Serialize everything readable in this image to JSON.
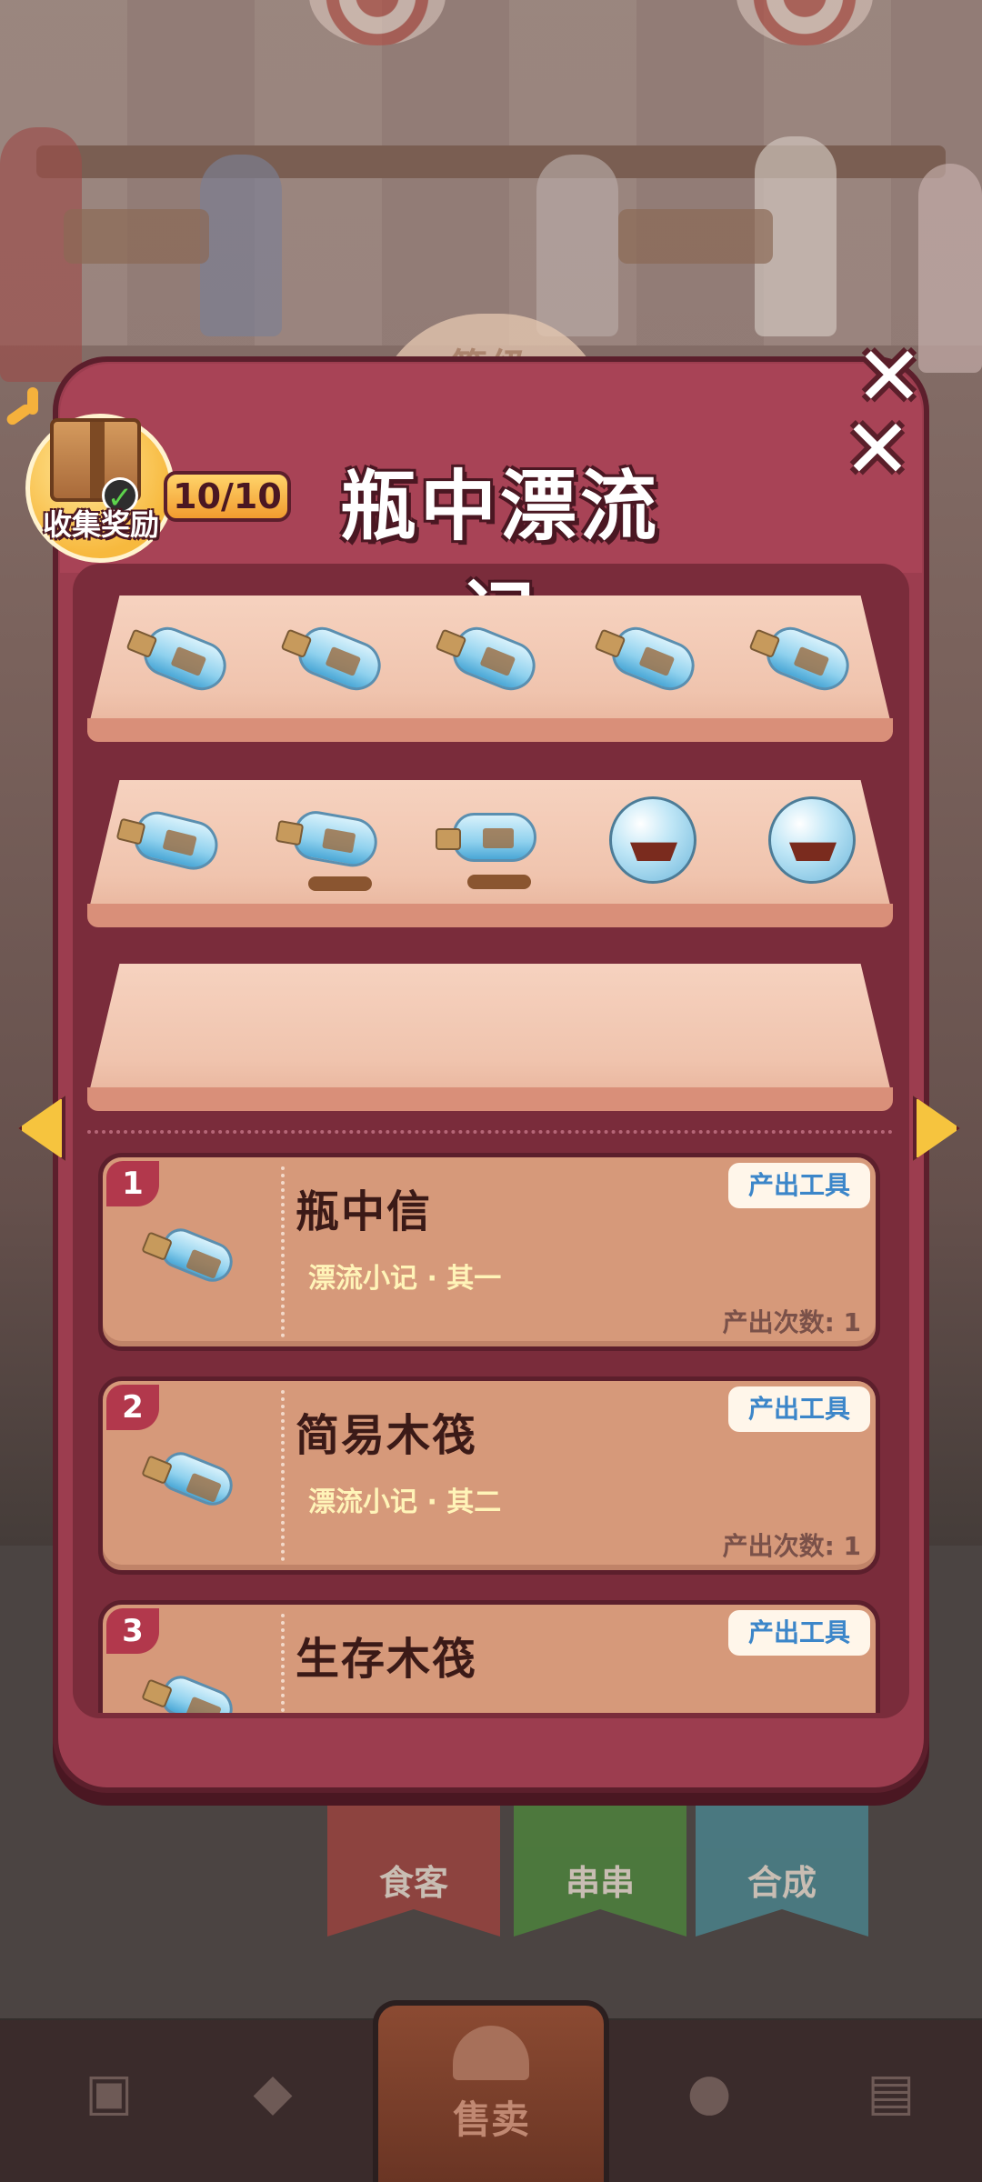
{
  "header": {
    "title": "瓶中漂流记",
    "progress": "10/10",
    "reward_label": "收集奖励",
    "level_label": "等级"
  },
  "shelves": {
    "row1": [
      "bottle-message",
      "bottle-raft",
      "bottle-survival-raft",
      "bottle-boat",
      "bottle-sailboat"
    ],
    "row2": [
      "bottle-sailship",
      "bottle-galleon",
      "bottle-red-galleon",
      "globe-steamship",
      "globe-liner"
    ],
    "row3": []
  },
  "items": [
    {
      "num": "1",
      "title": "瓶中信",
      "subtitle": "漂流小记 · 其一",
      "tag": "产出工具",
      "count": "产出次数: 1"
    },
    {
      "num": "2",
      "title": "简易木筏",
      "subtitle": "漂流小记 · 其二",
      "tag": "产出工具",
      "count": "产出次数: 1"
    },
    {
      "num": "3",
      "title": "生存木筏",
      "subtitle": "",
      "tag": "产出工具",
      "count": ""
    }
  ],
  "background": {
    "ribbon_left": "食客",
    "ribbon_mid": "串串",
    "ribbon_right": "合成"
  },
  "nav": {
    "active_label": "售卖",
    "icons": [
      "bag-icon",
      "handshake-icon",
      "bell-icon",
      "person-icon",
      "bus-icon"
    ]
  },
  "colors": {
    "panel": "#9c3d4f",
    "panel_dark": "#5c1f2c",
    "shelf": "#f0c4ae",
    "card": "#d6997a",
    "tag_text": "#3c86c9",
    "arrow": "#f6c43e"
  }
}
